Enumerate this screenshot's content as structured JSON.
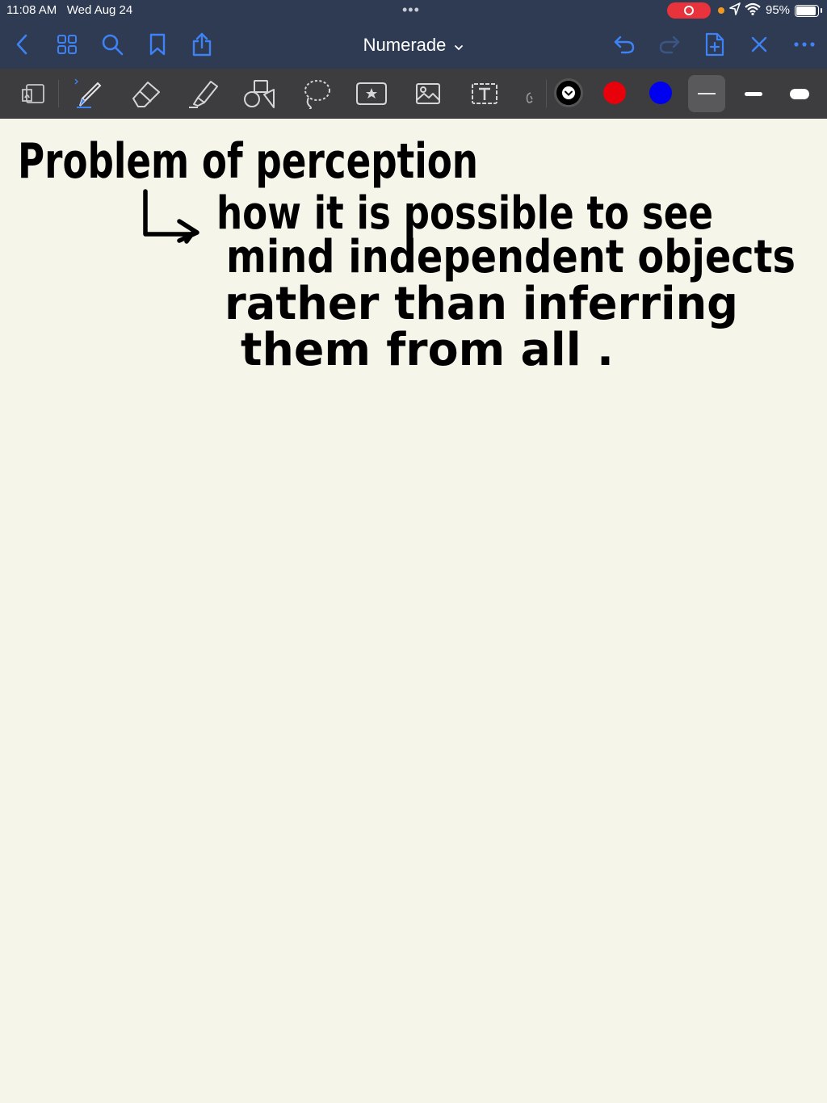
{
  "status": {
    "time": "11:08 AM",
    "date": "Wed Aug 24",
    "battery": "95%"
  },
  "nav": {
    "title": "Numerade",
    "accent": "#3d82f6"
  },
  "toolbar": {
    "colors": [
      "#000000",
      "#e8000b",
      "#0000f0"
    ],
    "tools": [
      "convert-to-text-icon",
      "pen-icon",
      "eraser-icon",
      "highlighter-icon",
      "shapes-icon",
      "lasso-icon",
      "elements-icon",
      "image-icon",
      "text-icon",
      "pointer-icon"
    ]
  },
  "notes": {
    "line1": "Problem of perception",
    "line2": "how it is possible to see",
    "line3": "mind independent objects",
    "line4": "rather than inferring",
    "line5": "them from all ."
  }
}
